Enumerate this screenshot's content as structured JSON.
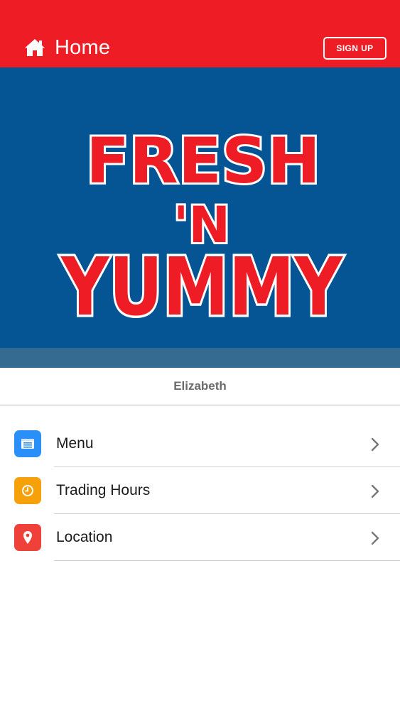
{
  "header": {
    "title": "Home",
    "home_icon": "home-icon",
    "signup_label": "SIGN UP",
    "color": "#ee1c25"
  },
  "hero": {
    "logo_line1": "FRESH",
    "logo_line2": "'N",
    "logo_line3": "YUMMY",
    "background": "#055494",
    "logo_color": "#ee1c25"
  },
  "location": {
    "name": "Elizabeth"
  },
  "menu": [
    {
      "label": "Menu",
      "icon": "menu-card-icon",
      "color": "#2a8ff7"
    },
    {
      "label": "Trading Hours",
      "icon": "clock-icon",
      "color": "#f7a10a"
    },
    {
      "label": "Location",
      "icon": "map-pin-icon",
      "color": "#f0403a"
    }
  ]
}
